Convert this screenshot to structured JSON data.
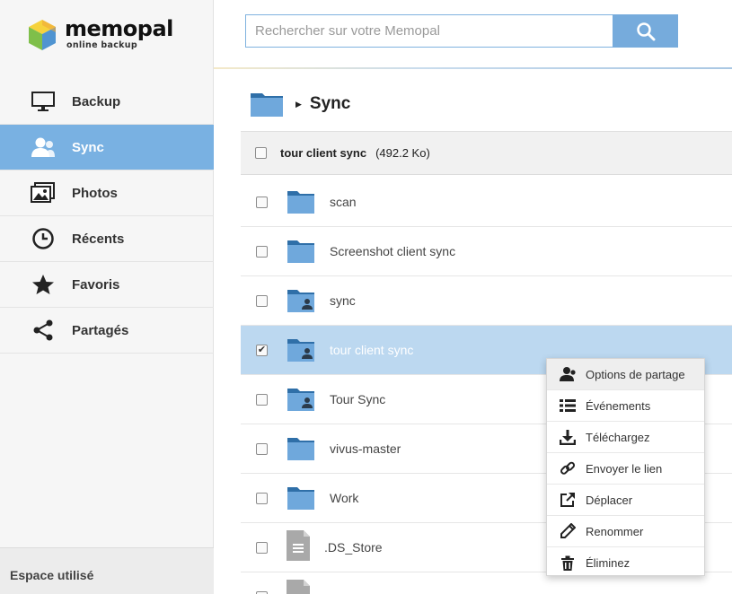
{
  "app": {
    "logo_name": "memopal",
    "logo_tagline": "online backup"
  },
  "sidebar": {
    "items": [
      {
        "label": "Backup",
        "icon": "monitor-icon"
      },
      {
        "label": "Sync",
        "icon": "user-sync-icon",
        "active": true
      },
      {
        "label": "Photos",
        "icon": "photos-icon"
      },
      {
        "label": "Récents",
        "icon": "clock-icon"
      },
      {
        "label": "Favoris",
        "icon": "star-icon"
      },
      {
        "label": "Partagés",
        "icon": "share-icon"
      }
    ],
    "usage_label": "Espace utilisé"
  },
  "search": {
    "placeholder": "Rechercher sur votre Memopal",
    "value": ""
  },
  "breadcrumb": {
    "title": "Sync"
  },
  "list": {
    "header_name": "tour client sync",
    "header_size": "(492.2 Ko)",
    "rows": [
      {
        "name": "scan",
        "type": "folder",
        "checked": false
      },
      {
        "name": "Screenshot client sync",
        "type": "folder",
        "checked": false
      },
      {
        "name": "sync",
        "type": "shared-folder",
        "checked": false
      },
      {
        "name": "tour client sync",
        "type": "shared-folder",
        "checked": true
      },
      {
        "name": "Tour Sync",
        "type": "shared-folder",
        "checked": false
      },
      {
        "name": "vivus-master",
        "type": "folder",
        "checked": false
      },
      {
        "name": "Work",
        "type": "folder",
        "checked": false
      },
      {
        "name": ".DS_Store",
        "type": "file",
        "checked": false
      }
    ]
  },
  "context_menu": {
    "items": [
      {
        "label": "Options de partage",
        "icon": "share-user-icon"
      },
      {
        "label": "Événements",
        "icon": "list-icon"
      },
      {
        "label": "Téléchargez",
        "icon": "download-icon"
      },
      {
        "label": "Envoyer le lien",
        "icon": "link-icon"
      },
      {
        "label": "Déplacer",
        "icon": "move-icon"
      },
      {
        "label": "Renommer",
        "icon": "pencil-icon"
      },
      {
        "label": "Éliminez",
        "icon": "trash-icon"
      }
    ]
  },
  "colors": {
    "accent": "#79b1e2",
    "selected_row": "#bcd8f0",
    "folder": "#6fa8dc"
  }
}
